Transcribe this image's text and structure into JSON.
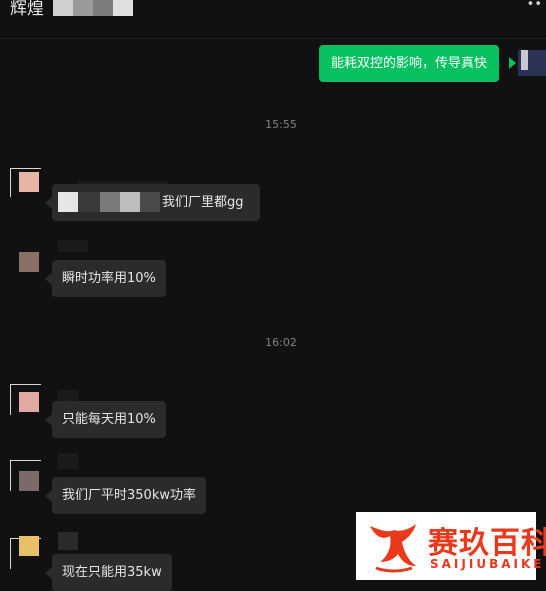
{
  "header": {
    "title": "辉煌"
  },
  "messages": {
    "outgoing_1": "能耗双控的影响，传导真快",
    "time_1": "15:55",
    "incoming_1": "我们厂里都gg",
    "incoming_2": "瞬时功率用10%",
    "time_2": "16:02",
    "incoming_3": "只能每天用10%",
    "incoming_4": "我们厂平时350kw功率",
    "incoming_5": "现在只能用35kw"
  },
  "watermark": {
    "cn": "赛玖百科",
    "en": "SAIJIUBAIKE"
  },
  "colors": {
    "accent": "#07c160",
    "bubble_in": "#2b2b2b",
    "background": "#111111",
    "brand": "#e8391d"
  }
}
